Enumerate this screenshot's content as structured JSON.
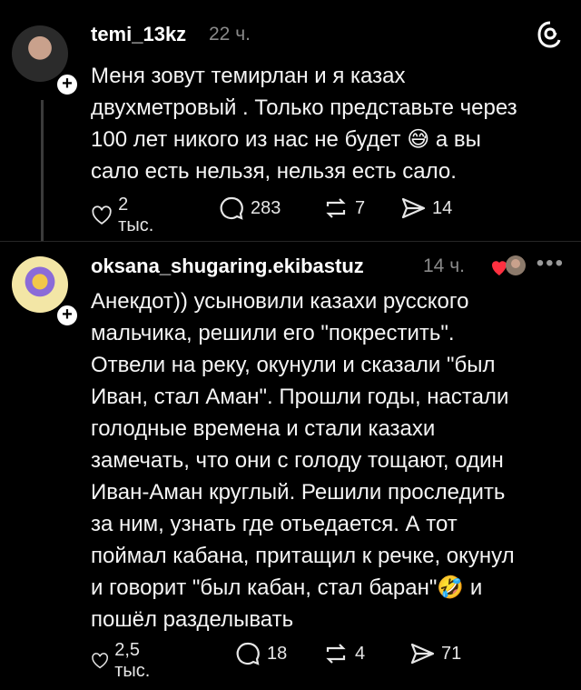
{
  "posts": [
    {
      "username": "temi_13kz",
      "time": "22 ч.",
      "text_before_emoji": "Меня зовут темирлан и я казах\nдвухметровый . Только представьте через\n100 лет никого из нас не будет ",
      "emoji": "😅",
      "text_after_emoji": " а вы\nсало есть нельзя, нельзя есть сало.",
      "likes": "2 тыс.",
      "comments": "283",
      "reposts": "7",
      "shares": "14"
    },
    {
      "username": "oksana_shugaring.ekibastuz",
      "time": "14 ч.",
      "text_before_emoji": "Анекдот)) усыновили казахи русского\nмальчика, решили его \"покрестить\".\nОтвели на реку, окунули и сказали \"был\nИван, стал Аман\". Прошли годы, настали\nголодные времена и стали казахи\nзамечать, что они с голоду тощают, один\nИван-Аман круглый. Решили проследить\nза ним, узнать где отьедается. А тот\nпоймал кабана, притащил к речке, окунул\nи говорит \"был кабан, стал баран\"",
      "emoji": "🤣",
      "text_after_emoji": " и\nпошёл разделывать",
      "likes": "2,5 тыс.",
      "comments": "18",
      "reposts": "4",
      "shares": "71"
    }
  ],
  "icons": {
    "threads": "threads-logo-icon",
    "like": "heart-icon",
    "comment": "comment-icon",
    "repost": "repost-icon",
    "share": "send-icon",
    "more": "more-icon"
  },
  "colors": {
    "background": "#000000",
    "muted": "#8a8a8a",
    "heart": "#ff3040"
  }
}
